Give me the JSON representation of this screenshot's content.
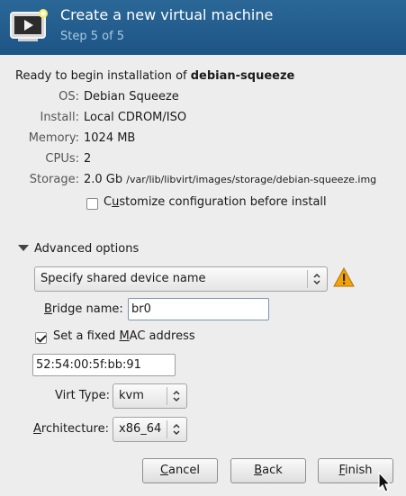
{
  "header": {
    "title": "Create a new virtual machine",
    "step": "Step 5 of 5"
  },
  "summary": {
    "ready_prefix": "Ready to begin installation of ",
    "vm_name": "debian-squeeze",
    "os_label": "OS:",
    "os_value": "Debian Squeeze",
    "install_label": "Install:",
    "install_value": "Local CDROM/ISO",
    "memory_label": "Memory:",
    "memory_value": "1024 MB",
    "cpus_label": "CPUs:",
    "cpus_value": "2",
    "storage_label": "Storage:",
    "storage_size": "2.0 Gb",
    "storage_path": "/var/lib/libvirt/images/storage/debian-squeeze.img"
  },
  "customize": {
    "label_before": "C",
    "label_mnemonic": "u",
    "label_after": "stomize configuration before install",
    "checked": false
  },
  "advanced": {
    "title": "Advanced options",
    "expanded": true,
    "network_source": "Specify shared device name",
    "warning_icon": "warning-icon",
    "bridge_label_mnemonic": "B",
    "bridge_label_rest": "ridge name:",
    "bridge_value": "br0",
    "mac_checkbox_before": "Set a fixed ",
    "mac_checkbox_mnemonic": "M",
    "mac_checkbox_after": "AC address",
    "mac_checked": true,
    "mac_value": "52:54:00:5f:bb:91",
    "virt_type_label": "Virt Type:",
    "virt_type_value": "kvm",
    "arch_label_mnemonic": "A",
    "arch_label_rest": "rchitecture:",
    "arch_value": "x86_64"
  },
  "buttons": {
    "cancel_mnemonic": "C",
    "cancel_rest": "ancel",
    "back_mnemonic": "B",
    "back_rest": "ack",
    "finish_mnemonic": "F",
    "finish_rest": "inish"
  },
  "colors": {
    "header_bg": "#1d5585",
    "header_step": "#a9c9e3",
    "warning": "#f0a30a"
  }
}
